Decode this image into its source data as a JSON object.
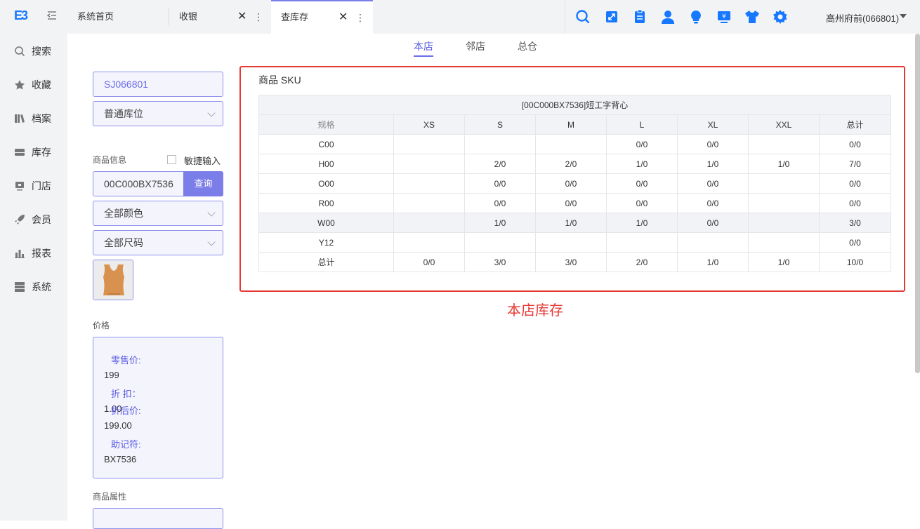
{
  "header": {
    "logo_text": "E3",
    "tabs": [
      {
        "label": "系统首页"
      },
      {
        "label": "收银"
      },
      {
        "label": "查库存"
      }
    ],
    "store": "高州府前(066801)",
    "toolbar_icons": [
      "search-icon",
      "expand-icon",
      "clipboard-icon",
      "user-icon",
      "bulb-icon",
      "cashier-icon",
      "shirt-icon",
      "gear-icon"
    ]
  },
  "sidebar": {
    "items": [
      {
        "label": "搜索",
        "icon": "search-icon"
      },
      {
        "label": "收藏",
        "icon": "star-icon"
      },
      {
        "label": "档案",
        "icon": "books-icon"
      },
      {
        "label": "库存",
        "icon": "box-icon"
      },
      {
        "label": "门店",
        "icon": "store-icon"
      },
      {
        "label": "会员",
        "icon": "rocket-icon"
      },
      {
        "label": "报表",
        "icon": "bar-chart-icon"
      },
      {
        "label": "系统",
        "icon": "server-icon"
      }
    ]
  },
  "subtabs": [
    {
      "label": "本店",
      "active": true
    },
    {
      "label": "邻店",
      "active": false
    },
    {
      "label": "总仓",
      "active": false
    }
  ],
  "filters": {
    "warehouse_code": "SJ066801",
    "location_type": "普通库位",
    "product_info_label": "商品信息",
    "quick_input_label": "敏捷输入",
    "product_code": "00C000BX7536",
    "query_button": "查询",
    "color": "全部颜色",
    "size": "全部尺码"
  },
  "price": {
    "section_label": "价格",
    "retail_label": "零售价:",
    "retail_value": "199",
    "discount_label": "折 扣：",
    "discount_value": "1.00",
    "after_label": "折后价:",
    "after_value": "199.00",
    "mnemonic_label": "助记符:",
    "mnemonic_value": "BX7536"
  },
  "attributes_label": "商品属性",
  "sku": {
    "title": "商品 SKU",
    "product_header": "[00C000BX7536]短工字背心",
    "columns": [
      "规格",
      "XS",
      "S",
      "M",
      "L",
      "XL",
      "XXL",
      "总计"
    ],
    "rows": [
      {
        "spec": "C00",
        "cells": [
          "",
          "",
          "",
          "0/0",
          "0/0",
          "",
          "0/0"
        ]
      },
      {
        "spec": "H00",
        "cells": [
          "",
          "2/0",
          "2/0",
          "1/0",
          "1/0",
          "1/0",
          "7/0"
        ]
      },
      {
        "spec": "O00",
        "cells": [
          "",
          "0/0",
          "0/0",
          "0/0",
          "0/0",
          "",
          "0/0"
        ]
      },
      {
        "spec": "R00",
        "cells": [
          "",
          "0/0",
          "0/0",
          "0/0",
          "0/0",
          "",
          "0/0"
        ]
      },
      {
        "spec": "W00",
        "cells": [
          "",
          "1/0",
          "1/0",
          "1/0",
          "0/0",
          "",
          "3/0"
        ],
        "highlight": true
      },
      {
        "spec": "Y12",
        "cells": [
          "",
          "",
          "",
          "",
          "",
          "",
          "0/0"
        ]
      },
      {
        "spec": "总计",
        "cells": [
          "0/0",
          "3/0",
          "3/0",
          "2/0",
          "1/0",
          "1/0",
          "10/0"
        ]
      }
    ]
  },
  "annotation": "本店库存",
  "colors": {
    "accent": "#7b7de8",
    "brand": "#1677ff",
    "annotation": "#e53935"
  }
}
